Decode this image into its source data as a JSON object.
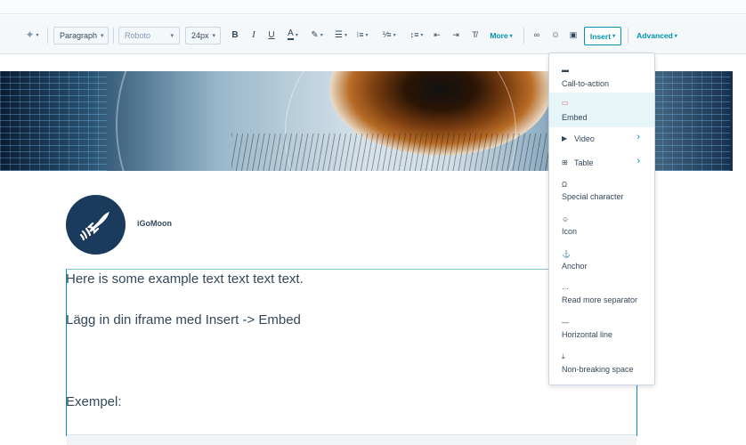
{
  "toolbar": {
    "paragraph_select": "Paragraph",
    "font_select": "Roboto",
    "size_select": "24px",
    "more_label": "More",
    "insert_label": "Insert",
    "advanced_label": "Advanced"
  },
  "brand": {
    "name": "iGoMoon"
  },
  "content": {
    "line1": "Here is some example text text text text.",
    "line2": "Lägg in din iframe med Insert -> Embed",
    "line3": "Exempel:"
  },
  "insert_menu": {
    "items": [
      {
        "label": "Call-to-action",
        "icon": "cta-icon"
      },
      {
        "label": "Embed",
        "icon": "embed-icon",
        "active": true
      },
      {
        "label": "Video",
        "icon": "video-icon",
        "submenu": true
      },
      {
        "label": "Table",
        "icon": "table-icon",
        "submenu": true
      },
      {
        "label": "Special character",
        "icon": "omega-icon"
      },
      {
        "label": "Icon",
        "icon": "smiley-icon"
      },
      {
        "label": "Anchor",
        "icon": "anchor-icon"
      },
      {
        "label": "Read more separator",
        "icon": "read-more-icon"
      },
      {
        "label": "Horizontal line",
        "icon": "horizontal-line-icon"
      },
      {
        "label": "Non-breaking space",
        "icon": "nbsp-icon"
      }
    ]
  }
}
